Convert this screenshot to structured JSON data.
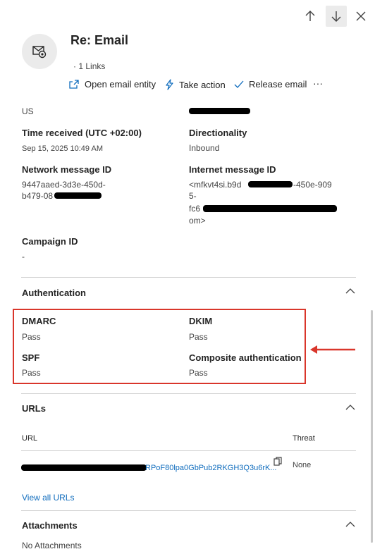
{
  "header": {
    "title": "Re: Email",
    "links_count": "1 Links",
    "actions": {
      "open_entity": "Open email entity",
      "take_action": "Take action",
      "release_email": "Release email",
      "more": "···"
    },
    "icons": [
      "up-arrow-icon",
      "down-arrow-icon",
      "close-icon",
      "email-envelope-icon"
    ]
  },
  "details": {
    "country": "US",
    "time_received_label": "Time received (UTC +02:00)",
    "time_received_value": "Sep 15, 2025 10:49 AM",
    "directionality_label": "Directionality",
    "directionality_value": "Inbound",
    "network_id_label": "Network message ID",
    "network_id_line1": "9447aaed-3d3e-450d-",
    "network_id_line2": "b479-08",
    "internet_id_label": "Internet message ID",
    "internet_id_line1": "<mfkvt4si.b9d",
    "internet_id_line1_end": "-450e-909",
    "internet_id_line2": "5-",
    "internet_id_line3": "fc6",
    "internet_id_line4": "om>",
    "campaign_label": "Campaign ID",
    "campaign_value": "-"
  },
  "authentication": {
    "title": "Authentication",
    "dmarc_label": "DMARC",
    "dmarc_value": "Pass",
    "dkim_label": "DKIM",
    "dkim_value": "Pass",
    "spf_label": "SPF",
    "spf_value": "Pass",
    "composite_label": "Composite authentication",
    "composite_value": "Pass"
  },
  "urls": {
    "title": "URLs",
    "col_url": "URL",
    "col_threat": "Threat",
    "rows": [
      {
        "url_visible": "RPoF80lpa0GbPub2RKGH3Q3u6rK...",
        "threat": "None"
      }
    ],
    "view_all": "View all URLs"
  },
  "attachments": {
    "title": "Attachments",
    "empty_text": "No Attachments"
  },
  "colors": {
    "accent": "#0f6cbd",
    "highlight": "#d9362b"
  }
}
